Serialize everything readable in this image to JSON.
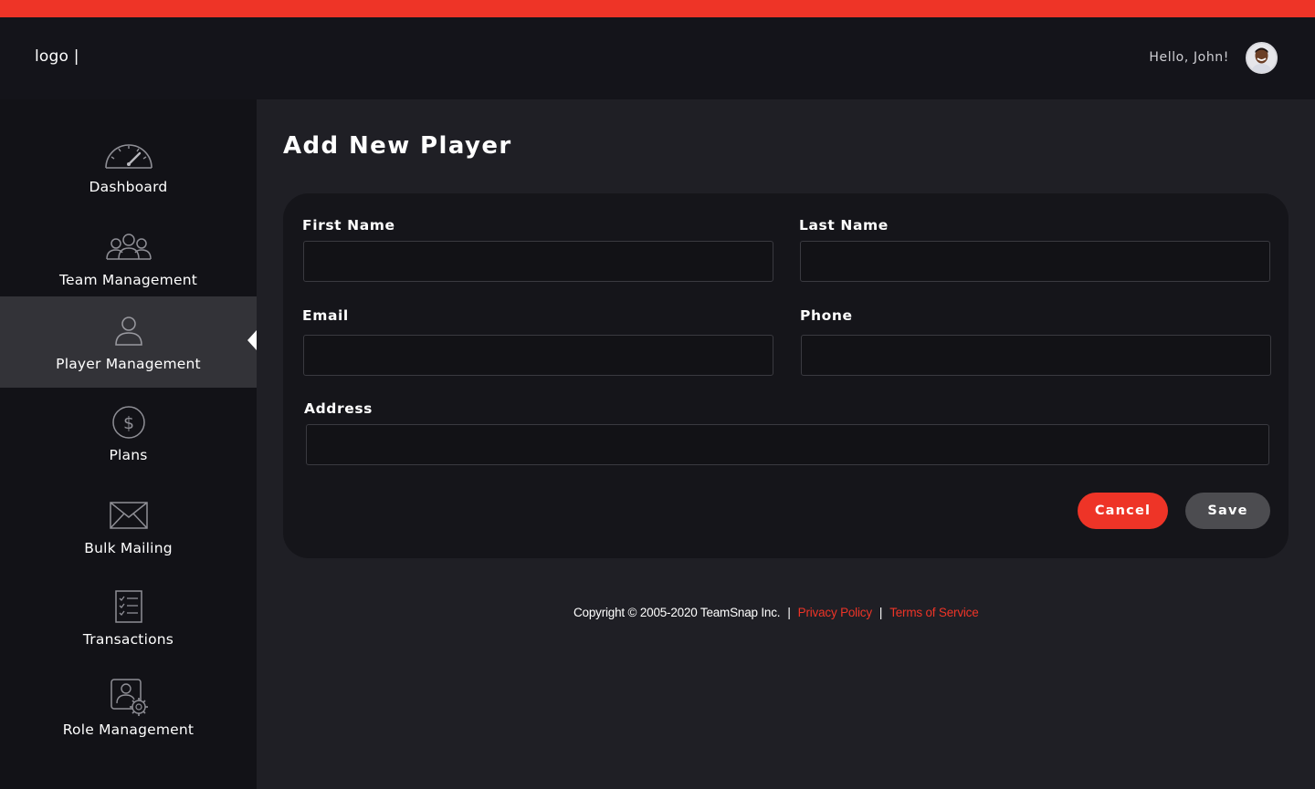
{
  "header": {
    "logo_text": "logo |",
    "greeting": "Hello, John!",
    "accent_color": "#ee3427",
    "avatar_icon": "user-avatar"
  },
  "sidebar": {
    "items": [
      {
        "label": "Dashboard",
        "icon": "speedometer-icon",
        "active": false
      },
      {
        "label": "Team Management",
        "icon": "team-group-icon",
        "active": false
      },
      {
        "label": "Player Management",
        "icon": "player-person-icon",
        "active": true
      },
      {
        "label": "Plans",
        "icon": "dollar-circle-icon",
        "active": false
      },
      {
        "label": "Bulk Mailing",
        "icon": "envelope-icon",
        "active": false
      },
      {
        "label": "Transactions",
        "icon": "checklist-icon",
        "active": false
      },
      {
        "label": "Role Management",
        "icon": "user-gear-icon",
        "active": false
      }
    ]
  },
  "main": {
    "title": "Add New Player",
    "form": {
      "first_name_label": "First Name",
      "first_name_value": "",
      "last_name_label": "Last Name",
      "last_name_value": "",
      "email_label": "Email",
      "email_value": "",
      "phone_label": "Phone",
      "phone_value": "",
      "address_label": "Address",
      "address_value": "",
      "cancel_label": "Cancel",
      "save_label": "Save"
    }
  },
  "footer": {
    "copyright": "Copyright © 2005-2020 TeamSnap Inc.",
    "separator": "|",
    "privacy_label": "Privacy Policy",
    "terms_label": "Terms of Service"
  }
}
